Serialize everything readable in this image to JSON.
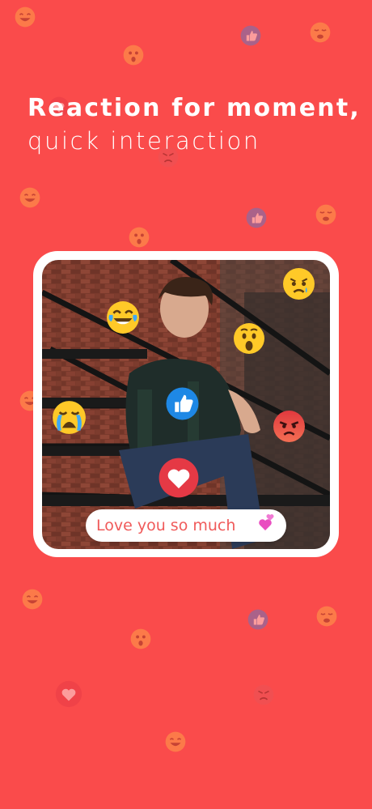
{
  "headline": {
    "line1": "Reaction for moment,",
    "line2": "quick interaction"
  },
  "message": {
    "text": "Love you so much"
  },
  "colors": {
    "background": "#FA4B4B",
    "like": "#1E88E5",
    "heart": "#E53945",
    "emoji_yellow": "#FFC928",
    "chip_text": "#F05A5A"
  },
  "reactions": [
    "laugh-icon",
    "cry-icon",
    "surprised-icon",
    "sad-icon",
    "angry-icon",
    "like-icon",
    "heart-icon"
  ]
}
